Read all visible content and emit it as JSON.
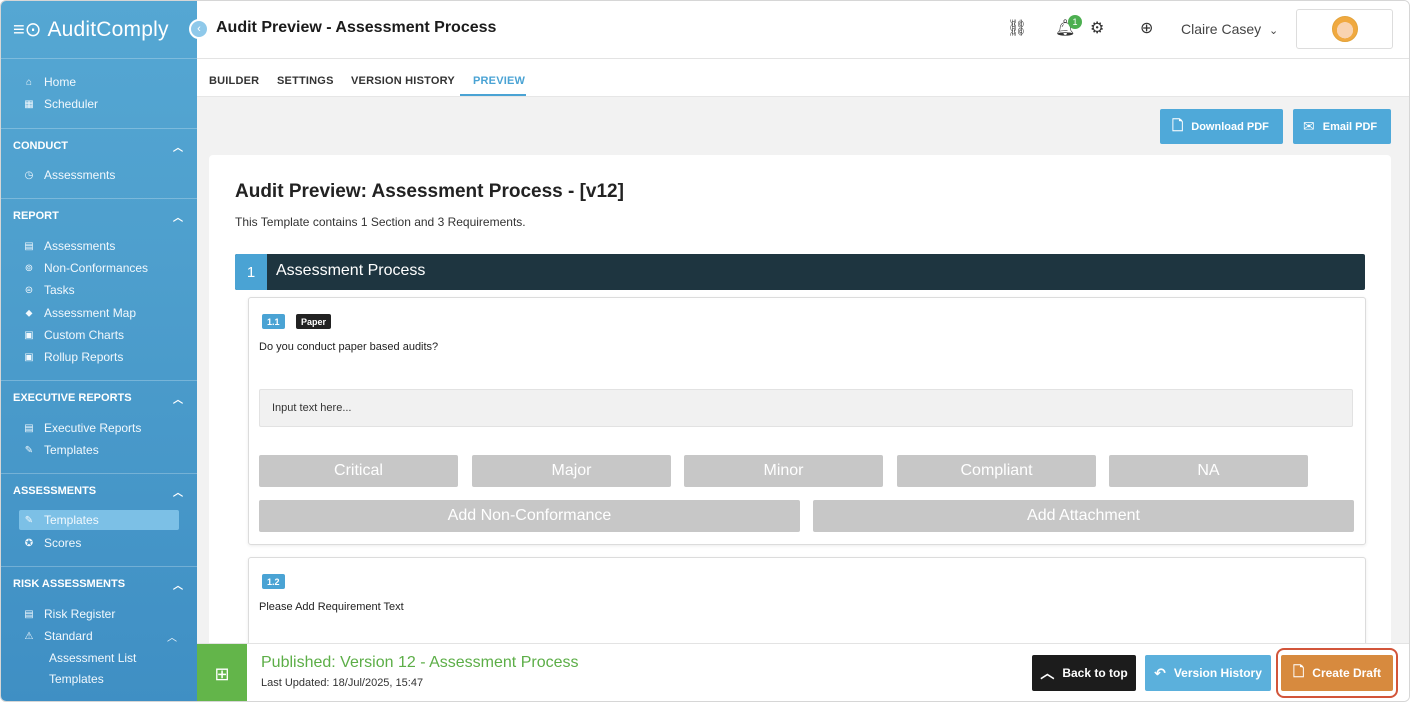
{
  "app": {
    "logo_text": "AuditComply"
  },
  "sidebar": {
    "top_items": [
      {
        "label": "Home",
        "icon": "home-icon"
      },
      {
        "label": "Scheduler",
        "icon": "calendar-icon"
      }
    ],
    "sections": {
      "conduct": {
        "title": "CONDUCT",
        "items": [
          "Assessments"
        ]
      },
      "report": {
        "title": "REPORT",
        "items": [
          "Assessments",
          "Non-Conformances",
          "Tasks",
          "Assessment Map",
          "Custom Charts",
          "Rollup Reports"
        ]
      },
      "executive_reports": {
        "title": "EXECUTIVE REPORTS",
        "items": [
          "Executive Reports",
          "Templates"
        ]
      },
      "assessments": {
        "title": "ASSESSMENTS",
        "items": [
          "Templates",
          "Scores"
        ]
      },
      "risk_assessments": {
        "title": "RISK ASSESSMENTS",
        "items": [
          "Risk Register",
          "Standard"
        ],
        "sub_items": [
          "Assessment List",
          "Templates"
        ]
      }
    }
  },
  "header": {
    "title": "Audit Preview - Assessment Process",
    "notification_count": "1",
    "user_name": "Claire Casey",
    "user_chevron": "⌄"
  },
  "tabs": [
    "BUILDER",
    "SETTINGS",
    "VERSION HISTORY",
    "PREVIEW"
  ],
  "actions": {
    "download_pdf": "Download PDF",
    "email_pdf": "Email PDF"
  },
  "preview": {
    "title": "Audit Preview: Assessment Process - [v12]",
    "subtitle": "This Template contains 1 Section and 3 Requirements.",
    "section_number": "1",
    "section_name": "Assessment Process",
    "requirements": [
      {
        "number": "1.1",
        "tag": "Paper",
        "text": "Do you conduct paper based audits?",
        "input_placeholder": "Input text here...",
        "grades": [
          "Critical",
          "Major",
          "Minor",
          "Compliant",
          "NA"
        ],
        "actions": [
          "Add Non-Conformance",
          "Add Attachment"
        ]
      },
      {
        "number": "1.2",
        "text": "Please Add Requirement Text"
      }
    ]
  },
  "footer": {
    "status": "Published: Version 12 - Assessment Process",
    "last_updated": "Last Updated: 18/Jul/2025, 15:47",
    "back_to_top": "Back to top",
    "version_history": "Version History",
    "create_draft": "Create Draft"
  },
  "colors": {
    "sidebar": "#4c9dcc",
    "accent": "#4aa3d4",
    "section_header": "#1e3540",
    "published_green": "#63b54a",
    "create_draft": "#d78a3e",
    "highlight": "#d2553a"
  }
}
